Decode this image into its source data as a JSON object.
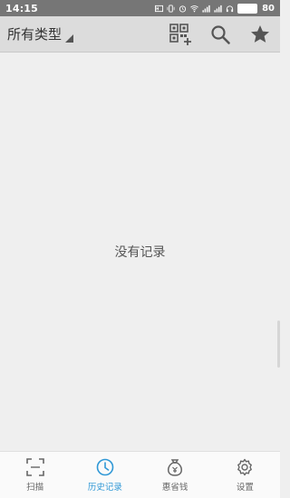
{
  "status_bar": {
    "time": "14:15",
    "battery": "80"
  },
  "toolbar": {
    "filter_label": "所有类型"
  },
  "content": {
    "empty_message": "没有记录"
  },
  "bottom_nav": {
    "items": [
      {
        "label": "扫描",
        "icon": "scan-icon",
        "active": false
      },
      {
        "label": "历史记录",
        "icon": "clock-icon",
        "active": true
      },
      {
        "label": "惠省钱",
        "icon": "money-bag-icon",
        "active": false
      },
      {
        "label": "设置",
        "icon": "gear-icon",
        "active": false
      }
    ]
  },
  "colors": {
    "status_bar_bg": "#767676",
    "toolbar_bg": "#dcdcdc",
    "content_bg": "#efefef",
    "accent": "#2f98d6",
    "icon_gray": "#666666"
  }
}
